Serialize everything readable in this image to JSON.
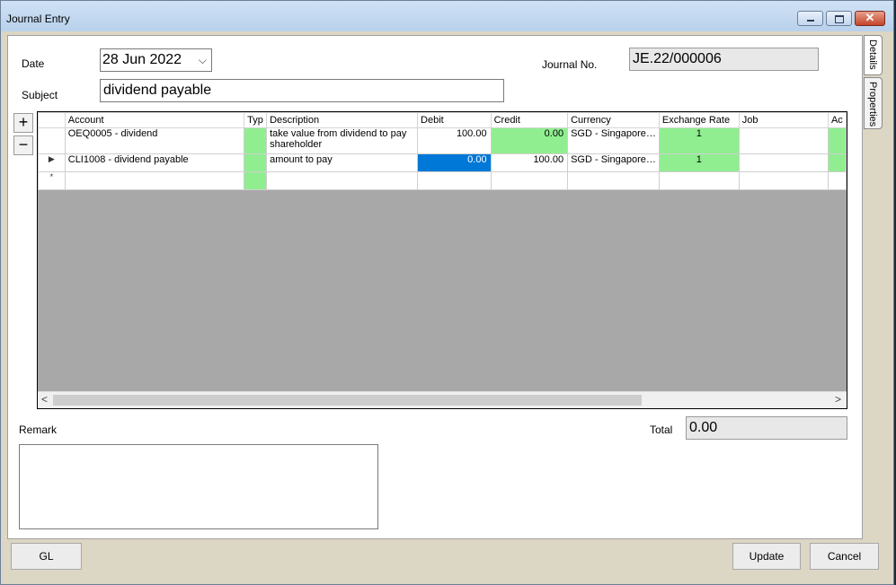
{
  "window": {
    "title": "Journal Entry"
  },
  "form": {
    "date_label": "Date",
    "date_value": "28 Jun  2022",
    "journal_no_label": "Journal No.",
    "journal_no_value": "JE.22/000006",
    "subject_label": "Subject",
    "subject_value": "dividend payable",
    "remark_label": "Remark",
    "remark_value": "",
    "total_label": "Total",
    "total_value": "0.00"
  },
  "grid": {
    "columns": [
      "Account",
      "Typ",
      "Description",
      "Debit",
      "Credit",
      "Currency",
      "Exchange Rate",
      "Job",
      "Ac"
    ],
    "rows": [
      {
        "account": "OEQ0005 - dividend",
        "description": "take value from dividend to pay shareholder",
        "debit": "100.00",
        "credit": "0.00",
        "currency": "SGD - Singapore…",
        "exchange_rate": "1"
      },
      {
        "account": "CLI1008 - dividend payable",
        "description": "amount to pay",
        "debit": "0.00",
        "credit": "100.00",
        "currency": "SGD - Singapore…",
        "exchange_rate": "1"
      }
    ],
    "current_row_marker": "▶",
    "new_row_marker": "*"
  },
  "side_buttons": {
    "add": "+",
    "remove": "−"
  },
  "tabs": [
    "Details",
    "Properties"
  ],
  "buttons": {
    "gl": "GL",
    "update": "Update",
    "cancel": "Cancel"
  },
  "icons": {
    "date_dropdown": "chevron-down-icon",
    "scroll_left": "chevron-left-icon",
    "scroll_right": "chevron-right-icon"
  },
  "colors": {
    "highlight_cell": "#90ee90",
    "selected_cell": "#0078d7",
    "grid_background": "#a8a8a8"
  }
}
